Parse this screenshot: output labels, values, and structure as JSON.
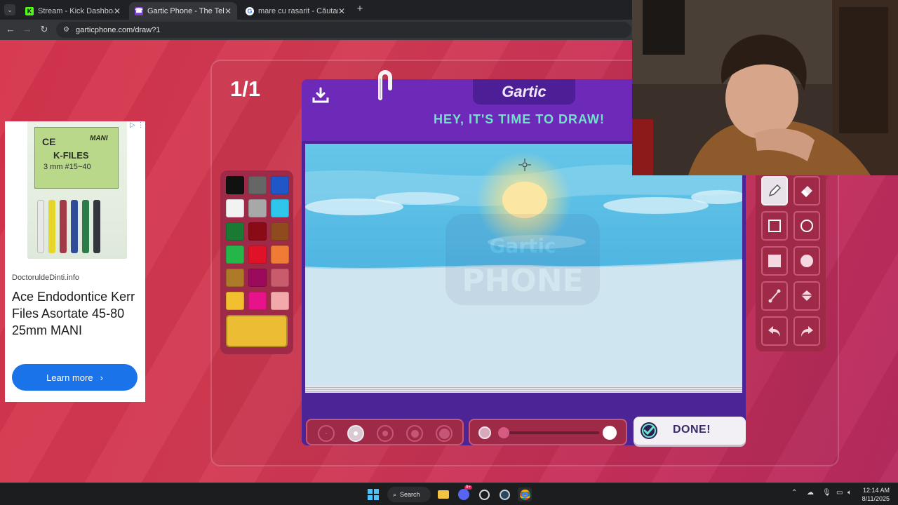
{
  "browser": {
    "tabs": [
      {
        "title": "Stream - Kick Dashboard",
        "favicon": "K"
      },
      {
        "title": "Gartic Phone - The Telephone Game",
        "favicon": "☎"
      },
      {
        "title": "mare cu rasarit - Căutare Google",
        "favicon": "G"
      }
    ],
    "new_tab": "+",
    "url": "garticphone.com/draw?1"
  },
  "game": {
    "round": "1/1",
    "logo": "Gartic",
    "prompt": "HEY, IT'S TIME TO DRAW!",
    "done_label": "DONE!",
    "watermark": "Gartic PHONE",
    "palette": [
      "#111111",
      "#666666",
      "#1f56c8",
      "#f2f2f2",
      "#a8a8a8",
      "#2ec6ea",
      "#1a7a33",
      "#8a0a16",
      "#8f4a1e",
      "#25b64a",
      "#e01228",
      "#ef7b34",
      "#ad7a2a",
      "#9c0a5c",
      "#c85c6c",
      "#f2c02e",
      "#e8138a",
      "#f3a9aa"
    ],
    "selected_color": "#ecbd33",
    "tools": [
      "pencil",
      "eraser",
      "rectangle-outline",
      "ellipse-outline",
      "rectangle-filled",
      "ellipse-filled",
      "line",
      "fill-bucket",
      "undo",
      "redo"
    ],
    "selected_tool": "pencil",
    "brush_sizes": [
      1,
      2,
      3,
      4,
      5
    ],
    "selected_size": 2,
    "opacity": 1.0
  },
  "ad": {
    "site": "DoctoruldeDinti.info",
    "title": "Ace Endodontice Kerr Files Asortate 45-80 25mm MANI",
    "cta": "Learn more",
    "product_brand": "K-FILES",
    "product_line1": "3 mm  #15~40",
    "product_maker": "MANI"
  },
  "taskbar": {
    "search": "Search",
    "time": "12:14 AM",
    "date": "8/11/2025",
    "discord_badge": "9+"
  },
  "colors": {
    "background": "#d23a52",
    "card": "#6d2ab8",
    "prompt": "#6fe3c8",
    "panel": "#9e2a47"
  }
}
